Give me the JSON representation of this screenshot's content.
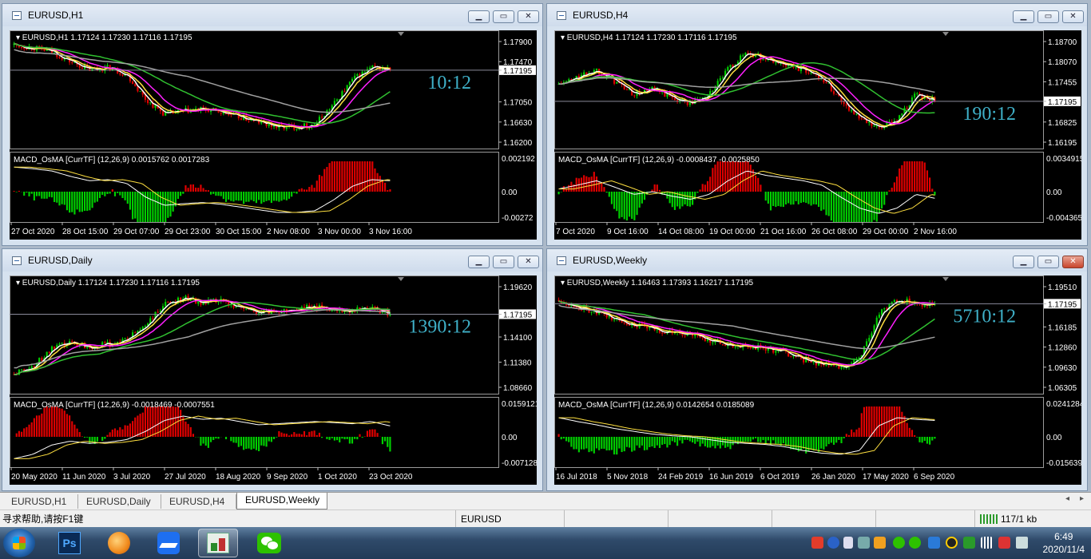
{
  "windows": [
    {
      "title": "EURUSD,H1",
      "price_header": "EURUSD,H1  1.17124 1.17230 1.17116 1.17195",
      "price_scale": [
        "1.17900",
        "1.17470",
        "1.17195",
        "1.17050",
        "1.16630",
        "1.16200"
      ],
      "current_price": "1.17195",
      "timer": "10:12",
      "indicator_header": "MACD_OsMA [CurrTF] (12,26,9) 0.0015762 0.0017283",
      "indicator_scale": [
        "0.002192",
        "0.00",
        "-0.00272"
      ],
      "time_labels": [
        "27 Oct 2020",
        "28 Oct 15:00",
        "29 Oct 07:00",
        "29 Oct 23:00",
        "30 Oct 15:00",
        "2 Nov 08:00",
        "3 Nov 00:00",
        "3 Nov 16:00"
      ]
    },
    {
      "title": "EURUSD,H4",
      "price_header": "EURUSD,H4  1.17124 1.17230 1.17116 1.17195",
      "price_scale": [
        "1.18700",
        "1.18070",
        "1.17455",
        "1.17195",
        "1.16825",
        "1.16195"
      ],
      "current_price": "1.17195",
      "timer": "190:12",
      "indicator_header": "MACD_OsMA [CurrTF] (12,26,9) -0.0008437 -0.0025850",
      "indicator_scale": [
        "0.0034915",
        "0.00",
        "-0.004365"
      ],
      "time_labels": [
        "7 Oct 2020",
        "9 Oct 16:00",
        "14 Oct 08:00",
        "19 Oct 00:00",
        "21 Oct 16:00",
        "26 Oct 08:00",
        "29 Oct 00:00",
        "2 Nov 16:00"
      ]
    },
    {
      "title": "EURUSD,Daily",
      "price_header": "EURUSD,Daily  1.17124 1.17230 1.17116 1.17195",
      "price_scale": [
        "1.19620",
        "1.17195",
        "1.14100",
        "1.11380",
        "1.08660"
      ],
      "current_price": "1.17195",
      "timer": "1390:12",
      "indicator_header": "MACD_OsMA [CurrTF] (12,26,9) -0.0018469 -0.0007551",
      "indicator_scale": [
        "0.0159121",
        "0.00",
        "-0.007128"
      ],
      "time_labels": [
        "20 May 2020",
        "11 Jun 2020",
        "3 Jul 2020",
        "27 Jul 2020",
        "18 Aug 2020",
        "9 Sep 2020",
        "1 Oct 2020",
        "23 Oct 2020"
      ]
    },
    {
      "title": "EURUSD,Weekly",
      "price_header": "EURUSD,Weekly  1.16463 1.17393 1.16217 1.17195",
      "price_scale": [
        "1.19510",
        "1.17195",
        "1.16185",
        "1.12860",
        "1.09630",
        "1.06305"
      ],
      "current_price": "1.17195",
      "timer": "5710:12",
      "indicator_header": "MACD_OsMA [CurrTF] (12,26,9) 0.0142654 0.0185089",
      "indicator_scale": [
        "0.0241284",
        "0.00",
        "-0.015639"
      ],
      "time_labels": [
        "16 Jul 2018",
        "5 Nov 2018",
        "24 Feb 2019",
        "16 Jun 2019",
        "6 Oct 2019",
        "26 Jan 2020",
        "17 May 2020",
        "6 Sep 2020"
      ]
    }
  ],
  "tabs": [
    "EURUSD,H1",
    "EURUSD,Daily",
    "EURUSD,H4",
    "EURUSD,Weekly"
  ],
  "active_tab": "EURUSD,Weekly",
  "tab_nav": [
    "◂",
    "▸"
  ],
  "status": {
    "help": "寻求帮助,请按F1键",
    "symbol": "EURUSD",
    "traffic": "117/1 kb"
  },
  "taskbar": {
    "time": "6:49",
    "date": "2020/11/4",
    "apps": [
      "Photoshop",
      "Browser",
      "Feishu",
      "MetaTrader",
      "WeChat"
    ],
    "ps_label": "Ps"
  },
  "window_buttons": {
    "minimize": "▁",
    "restore": "▭",
    "close": "✕"
  },
  "colors": {
    "bull": "#00d000",
    "bear": "#e00000",
    "ma_white": "#ffffff",
    "ma_yellow": "#ffe040",
    "ma_magenta": "#ff20ff",
    "ma_green": "#30c030",
    "ma_gray": "#a0a0a0",
    "timer": "#3fb0c8"
  }
}
